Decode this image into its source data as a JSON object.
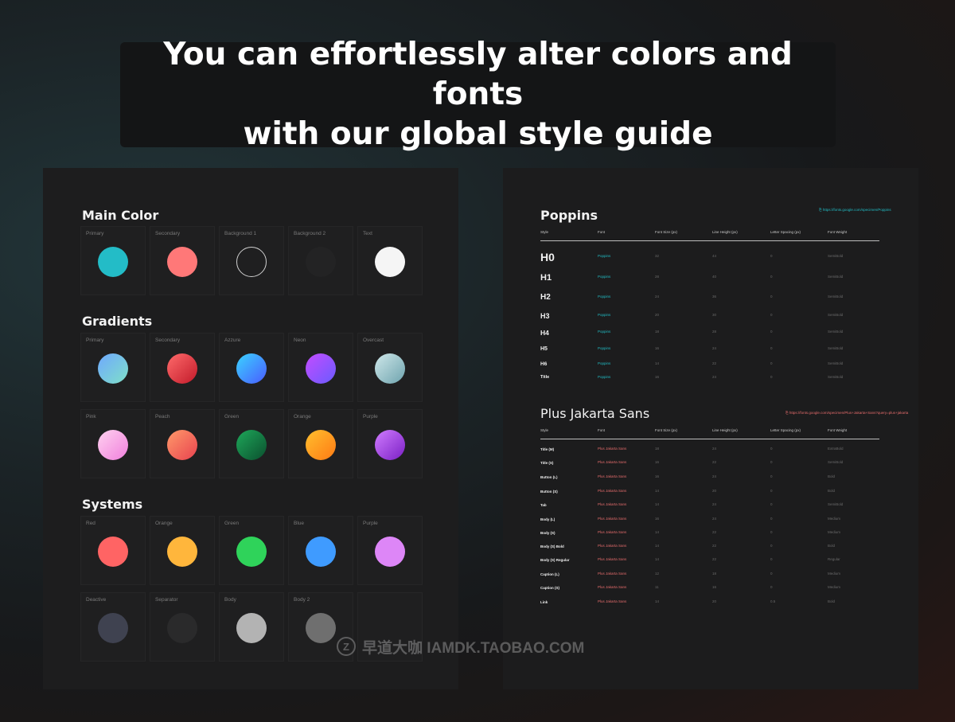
{
  "headline": {
    "line1": "You can effortlessly alter colors and fonts",
    "line2": "with our global style guide"
  },
  "left_panel": {
    "sections": [
      {
        "title": "Main Color",
        "cards": [
          {
            "label": "Primary",
            "color": "#23bcc7"
          },
          {
            "label": "Secondary",
            "color": "#ff7878"
          },
          {
            "label": "Background 1",
            "color": "outline"
          },
          {
            "label": "Background 2",
            "color": "#232324"
          },
          {
            "label": "Text",
            "color": "#f5f5f5"
          }
        ]
      },
      {
        "title": "Gradients",
        "cards": [
          {
            "label": "Primary",
            "gradient": "linear-gradient(135deg,#6fa8ff,#7fe0c8)"
          },
          {
            "label": "Secondary",
            "gradient": "linear-gradient(135deg,#ff6b6b,#c21a2a)"
          },
          {
            "label": "Azzure",
            "gradient": "linear-gradient(135deg,#3ad4ff,#4a5bff)"
          },
          {
            "label": "Neon",
            "gradient": "linear-gradient(135deg,#c44cff,#6a5bff)"
          },
          {
            "label": "Overcast",
            "gradient": "linear-gradient(135deg,#cfe8ea,#6ea3ae)"
          },
          {
            "label": "Pink",
            "gradient": "linear-gradient(135deg,#ffd2f0,#f07fdc)"
          },
          {
            "label": "Peach",
            "gradient": "linear-gradient(135deg,#ff9a6a,#e8424f)"
          },
          {
            "label": "Green",
            "gradient": "linear-gradient(135deg,#1ea85a,#0b4f2e)"
          },
          {
            "label": "Orange",
            "gradient": "linear-gradient(135deg,#ffbf2e,#ff7a14)"
          },
          {
            "label": "Purple",
            "gradient": "linear-gradient(135deg,#d07cff,#7a1fc4)"
          }
        ]
      },
      {
        "title": "Systems",
        "cards": [
          {
            "label": "Red",
            "color": "#ff6464"
          },
          {
            "label": "Orange",
            "color": "#ffb63c"
          },
          {
            "label": "Green",
            "color": "#2fd35a"
          },
          {
            "label": "Blue",
            "color": "#3f9bff"
          },
          {
            "label": "Purple",
            "color": "#dd86f7"
          },
          {
            "label": "Deactive",
            "color": "#3f4250"
          },
          {
            "label": "Separator",
            "color": "#2a2a2b"
          },
          {
            "label": "Body",
            "color": "#b3b3b3"
          },
          {
            "label": "Body 2",
            "color": "#6f6f6f"
          },
          {
            "label": "",
            "color": "none"
          }
        ]
      }
    ]
  },
  "right_panel": {
    "poppins": {
      "title": "Poppins",
      "link": "https://fonts.google.com/specimen/Poppins",
      "headers": [
        "Style",
        "Font",
        "Font Size (px)",
        "Line Height (px)",
        "Letter Spacing (px)",
        "Font Weight"
      ],
      "rows": [
        {
          "style": "H0",
          "font": "Poppins",
          "size": "32",
          "lh": "44",
          "ls": "0",
          "weight": "SemiBold"
        },
        {
          "style": "H1",
          "font": "Poppins",
          "size": "28",
          "lh": "40",
          "ls": "0",
          "weight": "SemiBold"
        },
        {
          "style": "H2",
          "font": "Poppins",
          "size": "24",
          "lh": "36",
          "ls": "0",
          "weight": "SemiBold"
        },
        {
          "style": "H3",
          "font": "Poppins",
          "size": "20",
          "lh": "30",
          "ls": "0",
          "weight": "SemiBold"
        },
        {
          "style": "H4",
          "font": "Poppins",
          "size": "18",
          "lh": "28",
          "ls": "0",
          "weight": "SemiBold"
        },
        {
          "style": "H5",
          "font": "Poppins",
          "size": "16",
          "lh": "24",
          "ls": "0",
          "weight": "SemiBold"
        },
        {
          "style": "H6",
          "font": "Poppins",
          "size": "14",
          "lh": "22",
          "ls": "0",
          "weight": "SemiBold"
        },
        {
          "style": "Title",
          "font": "Poppins",
          "size": "16",
          "lh": "24",
          "ls": "0",
          "weight": "SemiBold"
        }
      ]
    },
    "jakarta": {
      "title": "Plus Jakarta Sans",
      "link": "https://fonts.google.com/specimen/Plus+Jakarta+Sans?query=plus+jakarta",
      "headers": [
        "Style",
        "Font",
        "Font Size (px)",
        "Line Height (px)",
        "Letter Spacing (px)",
        "Font Weight"
      ],
      "rows": [
        {
          "style": "Title (M)",
          "font": "Plus Jakarta Sans",
          "size": "18",
          "lh": "24",
          "ls": "0",
          "weight": "ExtraBold"
        },
        {
          "style": "Title (S)",
          "font": "Plus Jakarta Sans",
          "size": "16",
          "lh": "22",
          "ls": "0",
          "weight": "SemiBold"
        },
        {
          "style": "Button (L)",
          "font": "Plus Jakarta Sans",
          "size": "16",
          "lh": "24",
          "ls": "0",
          "weight": "Bold"
        },
        {
          "style": "Button (S)",
          "font": "Plus Jakarta Sans",
          "size": "14",
          "lh": "20",
          "ls": "0",
          "weight": "Bold"
        },
        {
          "style": "Tab",
          "font": "Plus Jakarta Sans",
          "size": "14",
          "lh": "24",
          "ls": "0",
          "weight": "SemiBold"
        },
        {
          "style": "Body (L)",
          "font": "Plus Jakarta Sans",
          "size": "16",
          "lh": "24",
          "ls": "0",
          "weight": "Medium"
        },
        {
          "style": "Body (S)",
          "font": "Plus Jakarta Sans",
          "size": "14",
          "lh": "22",
          "ls": "0",
          "weight": "Medium"
        },
        {
          "style": "Body (S) Bold",
          "font": "Plus Jakarta Sans",
          "size": "14",
          "lh": "22",
          "ls": "0",
          "weight": "Bold"
        },
        {
          "style": "Body (S) Regular",
          "font": "Plus Jakarta Sans",
          "size": "14",
          "lh": "22",
          "ls": "0",
          "weight": "Regular"
        },
        {
          "style": "Caption (L)",
          "font": "Plus Jakarta Sans",
          "size": "12",
          "lh": "18",
          "ls": "0",
          "weight": "Medium"
        },
        {
          "style": "Caption (S)",
          "font": "Plus Jakarta Sans",
          "size": "11",
          "lh": "16",
          "ls": "0",
          "weight": "Medium"
        },
        {
          "style": "Link",
          "font": "Plus Jakarta Sans",
          "size": "14",
          "lh": "20",
          "ls": "0.5",
          "weight": "Bold"
        }
      ]
    }
  },
  "watermark": {
    "icon": "Z",
    "text": "早道大咖  IAMDK.TAOBAO.COM"
  }
}
